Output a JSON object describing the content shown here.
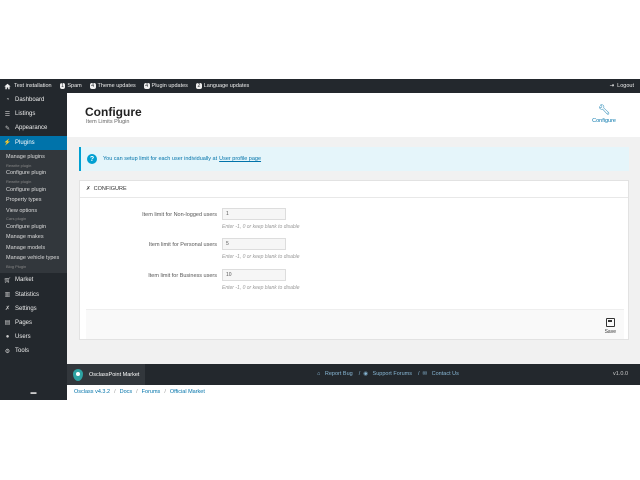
{
  "topbar": {
    "site": "Test installation",
    "items": [
      {
        "count": "1",
        "label": "Spam"
      },
      {
        "count": "4",
        "label": "Theme updates"
      },
      {
        "count": "4",
        "label": "Plugin updates"
      },
      {
        "count": "2",
        "label": "Language updates"
      }
    ],
    "logout": "Logout"
  },
  "sidebar": {
    "top": [
      "Dashboard",
      "Listings",
      "Appearance"
    ],
    "active": "Plugins",
    "sub": [
      {
        "label": "Manage plugins",
        "small": false
      },
      {
        "label": "Rewrite plugin",
        "small": true
      },
      {
        "label": "Configure plugin",
        "small": false
      },
      {
        "label": "Rewrite plugin",
        "small": true
      },
      {
        "label": "Configure plugin",
        "small": false
      },
      {
        "label": "Property types",
        "small": false
      },
      {
        "label": "View options",
        "small": false
      },
      {
        "label": "Cars plugin",
        "small": true
      },
      {
        "label": "Configure plugin",
        "small": false
      },
      {
        "label": "Manage makes",
        "small": false
      },
      {
        "label": "Manage models",
        "small": false
      },
      {
        "label": "Manage vehicle types",
        "small": false
      },
      {
        "label": "Blog Plugin",
        "small": true
      }
    ],
    "bottom": [
      "Market",
      "Statistics",
      "Settings",
      "Pages",
      "Users",
      "Tools"
    ]
  },
  "header": {
    "title": "Configure",
    "subtitle": "Item Limits Plugin",
    "configure_label": "Configure"
  },
  "notice": {
    "text": "You can setup limit for each user individually at",
    "link": "User profile page"
  },
  "panel": {
    "heading": "CONFIGURE",
    "fields": [
      {
        "label": "Item limit for Non-logged users",
        "value": "1",
        "hint": "Enter -1, 0 or keep blank to disable"
      },
      {
        "label": "Item limit for Personal users",
        "value": "5",
        "hint": "Enter -1, 0 or keep blank to disable"
      },
      {
        "label": "Item limit for Business users",
        "value": "10",
        "hint": "Enter -1, 0 or keep blank to disable"
      }
    ],
    "save": "Save"
  },
  "footer": {
    "brand": "OsclassPoint Market",
    "links": [
      "Report Bug",
      "/",
      "Support Forums",
      "/",
      "Contact Us"
    ],
    "version": "v1.0.0"
  },
  "crumbs": [
    "Osclass v4.3.2",
    "Docs",
    "Forums",
    "Official Market"
  ]
}
